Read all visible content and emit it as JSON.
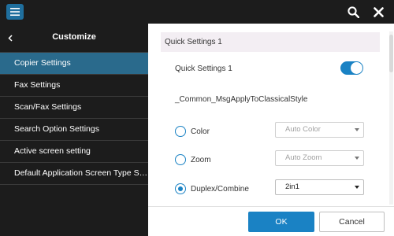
{
  "topbar": {
    "menu_icon": "hamburger-icon",
    "search_icon": "search-icon",
    "close_icon": "close-icon"
  },
  "sidebar": {
    "title": "Customize",
    "back_icon": "chevron-left-icon",
    "items": [
      {
        "label": "Copier Settings",
        "active": true
      },
      {
        "label": "Fax Settings",
        "active": false
      },
      {
        "label": "Scan/Fax Settings",
        "active": false
      },
      {
        "label": "Search Option Settings",
        "active": false
      },
      {
        "label": "Active screen setting",
        "active": false
      },
      {
        "label": "Default Application Screen Type Se...",
        "active": false
      }
    ]
  },
  "main": {
    "section_title": "Quick Settings 1",
    "quick_settings_label": "Quick Settings 1",
    "quick_settings_enabled": true,
    "classical_style_label": "_Common_MsgApplyToClassicalStyle",
    "options": [
      {
        "label": "Color",
        "selected": false,
        "value": "Auto Color",
        "enabled": false
      },
      {
        "label": "Zoom",
        "selected": false,
        "value": "Auto Zoom",
        "enabled": false
      },
      {
        "label": "Duplex/Combine",
        "selected": true,
        "value": "2in1",
        "enabled": true
      }
    ]
  },
  "footer": {
    "ok_label": "OK",
    "cancel_label": "Cancel"
  },
  "colors": {
    "accent": "#1a82c4",
    "sidebar_bg": "#1c1c1c",
    "sidebar_active": "#2a6a8c",
    "section_header_bg": "#f3eef3"
  }
}
